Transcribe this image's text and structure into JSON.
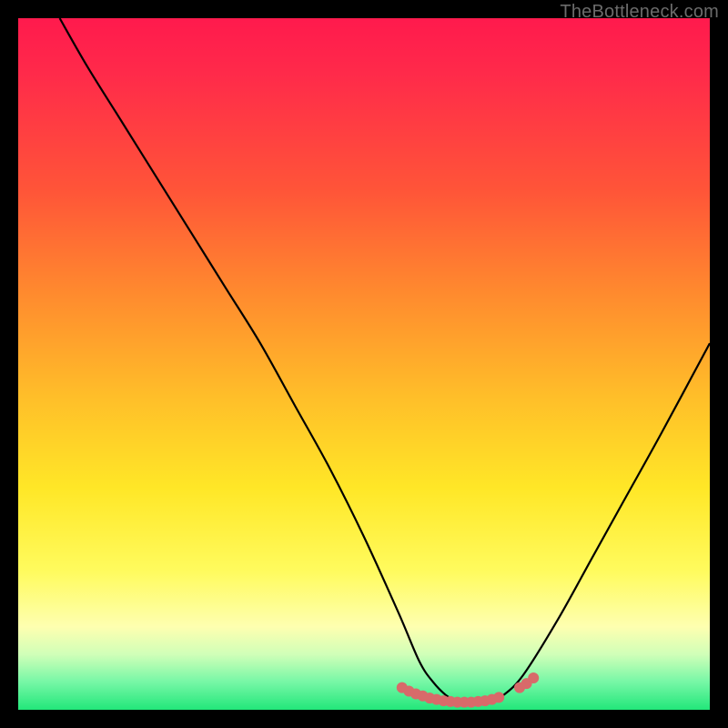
{
  "attribution": "TheBottleneck.com",
  "colors": {
    "background": "#000000",
    "curve": "#000000",
    "marker": "#d86a6a",
    "gradient_top": "#ff1a4d",
    "gradient_bottom": "#22e77a"
  },
  "chart_data": {
    "type": "line",
    "title": "",
    "xlabel": "",
    "ylabel": "",
    "xlim": [
      0,
      100
    ],
    "ylim": [
      0,
      100
    ],
    "series": [
      {
        "name": "bottleneck-curve",
        "x": [
          6,
          10,
          15,
          20,
          25,
          30,
          35,
          40,
          45,
          50,
          55,
          58,
          60,
          62,
          64,
          66,
          68,
          70,
          73,
          78,
          83,
          88,
          93,
          100
        ],
        "y": [
          100,
          93,
          85,
          77,
          69,
          61,
          53,
          44,
          35,
          25,
          14,
          7,
          4,
          2,
          1,
          1,
          1,
          2,
          5,
          13,
          22,
          31,
          40,
          53
        ]
      }
    ],
    "markers": [
      {
        "name": "highlight-segment-left",
        "x": [
          55.5,
          56.5,
          57.5,
          58.5,
          59.5,
          60.5,
          61.5,
          62.5,
          63.5,
          64.5,
          65.5,
          66.5,
          67.5,
          68.5,
          69.5
        ],
        "y": [
          3.2,
          2.7,
          2.3,
          2.0,
          1.7,
          1.5,
          1.3,
          1.2,
          1.1,
          1.1,
          1.1,
          1.2,
          1.3,
          1.5,
          1.8
        ]
      },
      {
        "name": "highlight-segment-right",
        "x": [
          72.5,
          73.5,
          74.5
        ],
        "y": [
          3.2,
          3.8,
          4.6
        ]
      }
    ]
  }
}
